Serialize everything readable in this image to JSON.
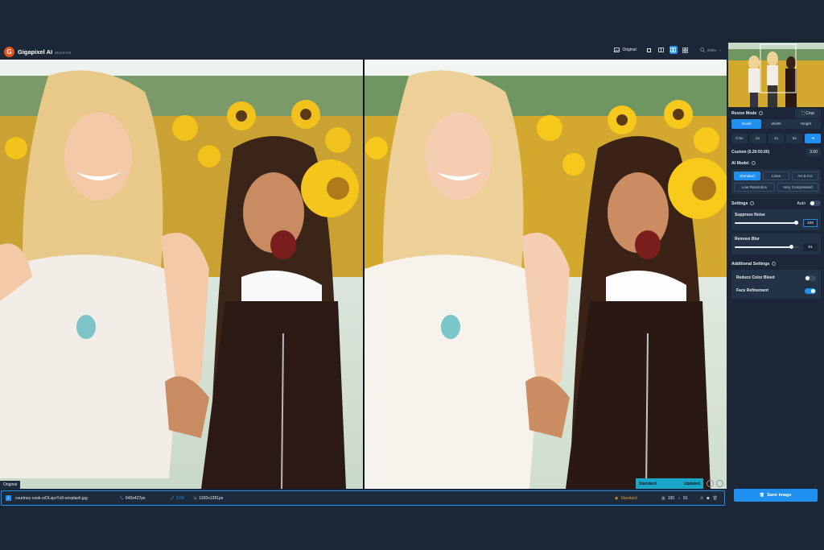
{
  "app": {
    "name": "Gigapixel AI",
    "version": "v5.8.0-rc2",
    "logo_letter": "G"
  },
  "toolbar": {
    "original_label": "Original",
    "zoom": "200%"
  },
  "preview": {
    "original_tag": "Original",
    "state_model": "Standard",
    "state_status": "Updated"
  },
  "file": {
    "checked": "✓",
    "name": "courtney-cook-xrDLsjsrYz8-unsplash.jpg",
    "input_size": "640x427px",
    "scale": "3.00",
    "output_size": "1920x1281px",
    "model": "Standard",
    "noise": "100",
    "blur": "91"
  },
  "panel": {
    "resize_mode_title": "Resize Mode",
    "crop_label": "Crop",
    "resize_tabs": [
      "Scale",
      "Width",
      "Height"
    ],
    "scale_options": [
      "0.5x",
      "2x",
      "4x",
      "6x",
      "⇥"
    ],
    "custom_label": "Custom (0.20-50.00)",
    "custom_value": "3.00",
    "ai_model_title": "AI Model",
    "models_row1": [
      "Standard",
      "Lines",
      "Art & CG"
    ],
    "models_row2": [
      "Low Resolution",
      "Very Compressed"
    ],
    "settings_title": "Settings",
    "auto_label": "Auto",
    "suppress_noise_label": "Suppress Noise",
    "suppress_noise_value": "100",
    "suppress_noise_level": 0.95,
    "remove_blur_label": "Remove Blur",
    "remove_blur_value": "91",
    "remove_blur_level": 0.88,
    "additional_title": "Additional Settings",
    "reduce_color_bleed_label": "Reduce Color Bleed",
    "face_refinement_label": "Face Refinement",
    "save_label": "Save Image"
  },
  "colors": {
    "accent": "#1f8ff0",
    "background": "#1b2636",
    "brand": "#e2561f"
  }
}
